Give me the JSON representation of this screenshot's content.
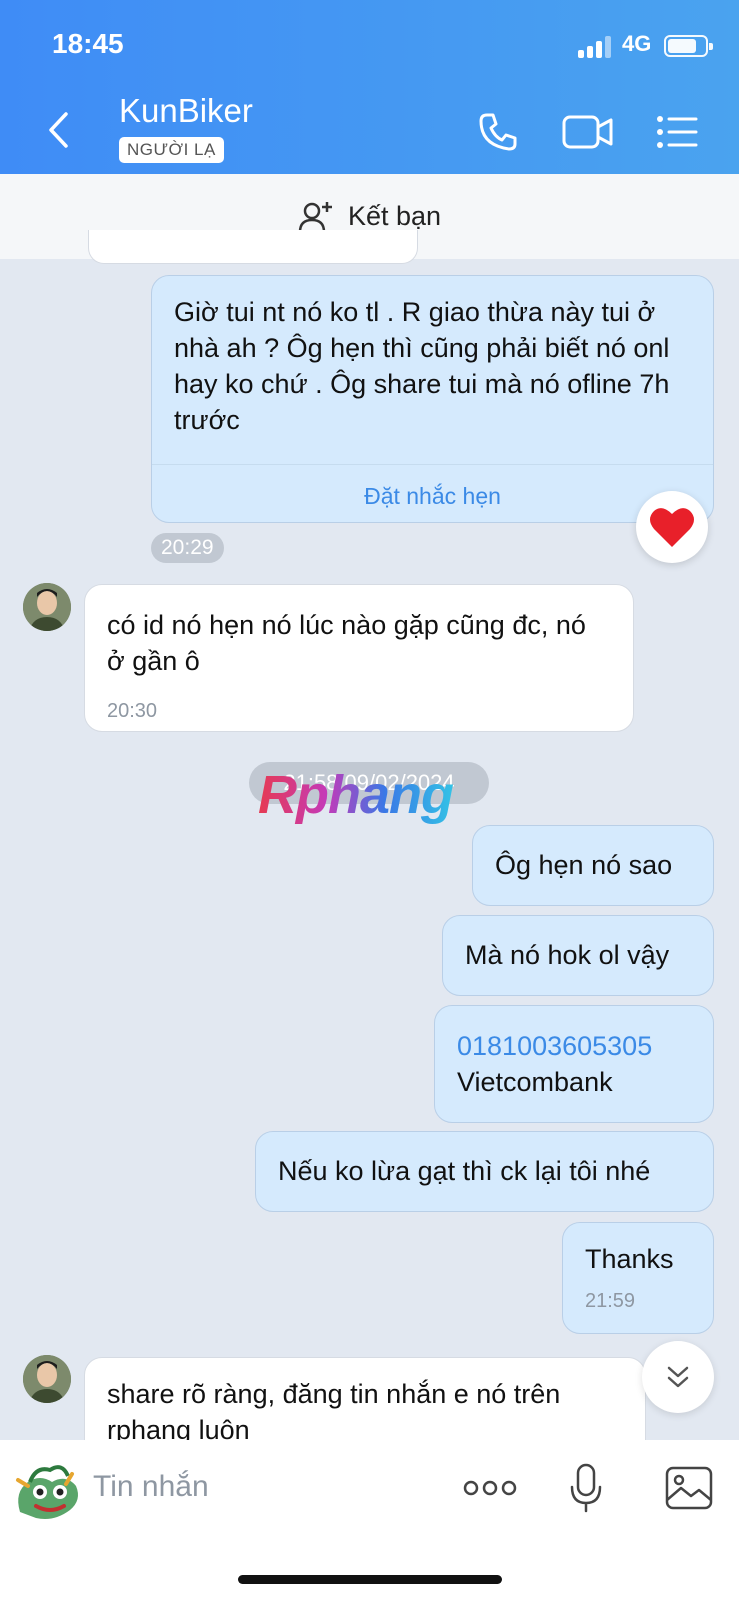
{
  "status_bar": {
    "time": "18:45",
    "network": "4G"
  },
  "header": {
    "title": "KunBiker",
    "badge": "NGƯỜI LẠ"
  },
  "add_friend": {
    "label": "Kết bạn"
  },
  "messages": {
    "m1": {
      "text": "Giờ tui nt nó ko tl . R giao thừa này tui ở nhà ah ? Ôg hẹn thì cũng phải biết nó onl hay ko chứ . Ôg share tui mà nó ofline 7h trước",
      "action": "Đặt nhắc hẹn",
      "time": "20:29",
      "reaction": "heart"
    },
    "m2": {
      "text": "có id nó hẹn nó lúc nào gặp cũng đc, nó ở gần ô",
      "time": "20:30"
    },
    "date_separator": "21:58 09/02/2024",
    "m3": {
      "text": "Ôg hẹn nó sao"
    },
    "m4": {
      "text": "Mà nó hok ol vậy"
    },
    "m5": {
      "account": "0181003605305",
      "bank": "Vietcombank"
    },
    "m6": {
      "text": "Nếu ko lừa gạt thì ck lại tôi nhé"
    },
    "m7": {
      "text": "Thanks",
      "time": "21:59"
    },
    "m8": {
      "text": "share rõ ràng, đăng tin nhắn e nó trên rphang luôn"
    }
  },
  "watermark": "Rphang",
  "composer": {
    "placeholder": "Tin nhắn"
  },
  "colors": {
    "header_start": "#3f8cf6",
    "header_end": "#4aa3ef",
    "outgoing_bubble": "#d5eafd",
    "chat_bg": "#e2e8f1",
    "link": "#3b8ae6"
  },
  "icons": [
    "back-icon",
    "phone-icon",
    "video-call-icon",
    "menu-list-icon",
    "add-friend-icon",
    "heart-icon",
    "chevron-double-down-icon",
    "sticker-icon",
    "more-icon",
    "microphone-icon",
    "image-icon"
  ]
}
